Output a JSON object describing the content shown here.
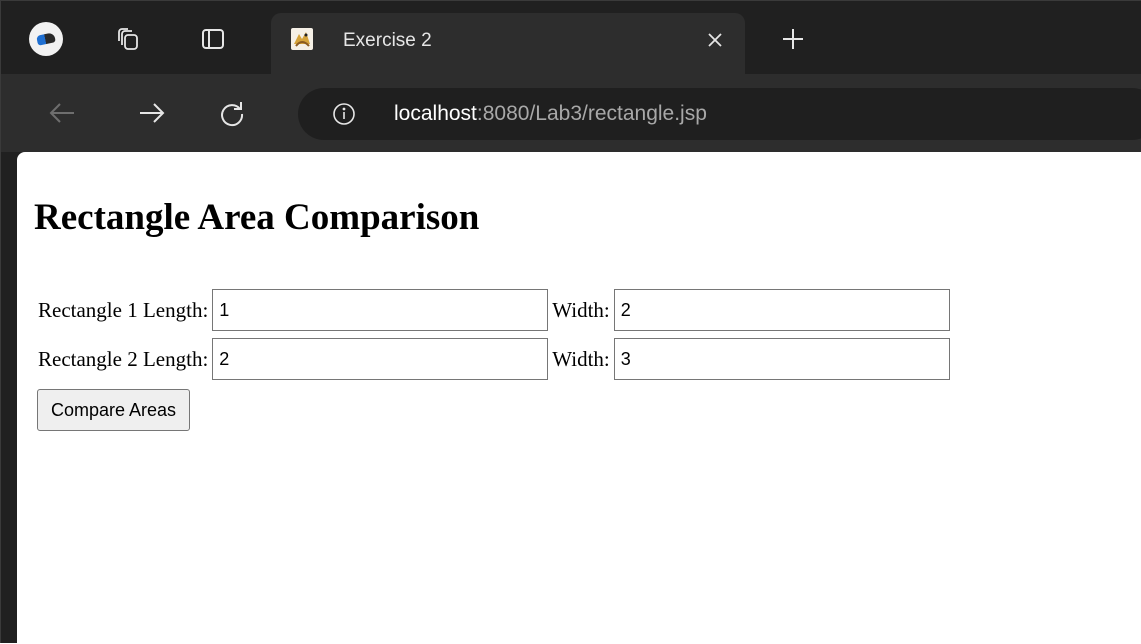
{
  "browser": {
    "tab_title": "Exercise 2",
    "url_host": "localhost",
    "url_rest": ":8080/Lab3/rectangle.jsp"
  },
  "icons": {
    "profile": "profile-avatar-icon",
    "workspaces": "workspaces-icon",
    "tab_actions": "tab-actions-icon",
    "favicon": "tomcat-favicon-icon",
    "close": "close-icon",
    "new_tab": "plus-icon",
    "back": "back-arrow-icon",
    "forward": "forward-arrow-icon",
    "refresh": "refresh-icon",
    "info": "info-icon"
  },
  "page": {
    "heading": "Rectangle Area Comparison",
    "rect1": {
      "length_label": "Rectangle 1 Length:",
      "length_value": "1",
      "width_label": "Width:",
      "width_value": "2"
    },
    "rect2": {
      "length_label": "Rectangle 2 Length:",
      "length_value": "2",
      "width_label": "Width:",
      "width_value": "3"
    },
    "compare_button": "Compare Areas"
  },
  "colors": {
    "chrome_dark": "#202020",
    "toolbar": "#2d2d2d",
    "page_bg": "#ffffff"
  }
}
